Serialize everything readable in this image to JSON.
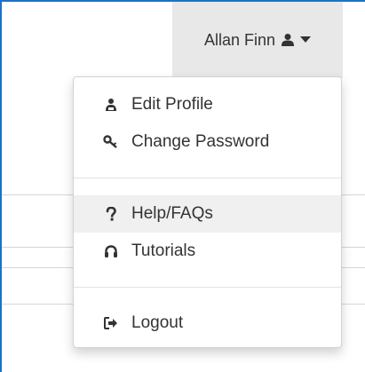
{
  "navbar": {
    "user_name": "Allan Finn",
    "user_icon": "user-icon",
    "caret_icon": "caret-down-icon"
  },
  "menu": {
    "items": [
      {
        "label": "Edit Profile",
        "icon": "user-edit-icon"
      },
      {
        "label": "Change Password",
        "icon": "key-icon"
      },
      {
        "label": "Help/FAQs",
        "icon": "question-icon"
      },
      {
        "label": "Tutorials",
        "icon": "headphones-icon"
      },
      {
        "label": "Logout",
        "icon": "logout-icon"
      }
    ]
  },
  "colors": {
    "frame_border": "#1a73c9",
    "toggle_bg": "#e8e8e8",
    "text": "#333333",
    "hover_bg": "#f0f0f0"
  }
}
